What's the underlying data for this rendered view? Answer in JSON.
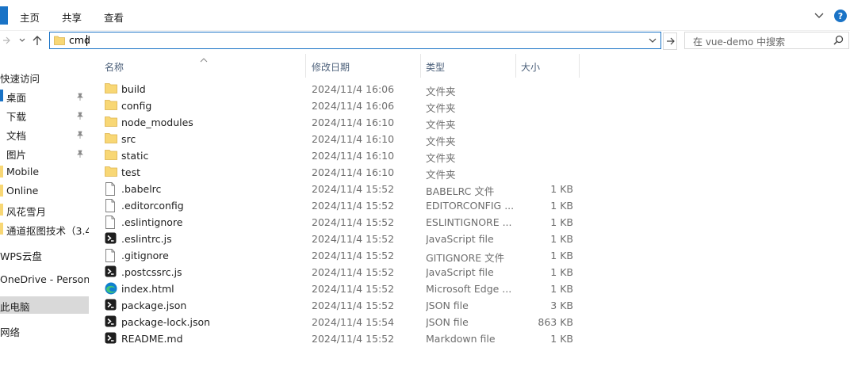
{
  "ribbon": {
    "tabs": [
      "主页",
      "共享",
      "查看"
    ]
  },
  "address": {
    "value": "cmd"
  },
  "search": {
    "placeholder": "在 vue-demo 中搜索"
  },
  "sidebar": {
    "items": [
      {
        "label": "快速访问",
        "pinned": false
      },
      {
        "label": "桌面",
        "pinned": true
      },
      {
        "label": "下载",
        "pinned": true
      },
      {
        "label": "文档",
        "pinned": true
      },
      {
        "label": "图片",
        "pinned": true
      },
      {
        "label": "Mobile",
        "pinned": false
      },
      {
        "label": "Online",
        "pinned": false
      },
      {
        "label": "风花雪月",
        "pinned": false
      },
      {
        "label": "通道抠图技术（3.4",
        "pinned": false
      },
      {
        "label": "WPS云盘",
        "pinned": false
      },
      {
        "label": "OneDrive - Persona",
        "pinned": false
      },
      {
        "label": "此电脑",
        "pinned": false,
        "selected": true
      },
      {
        "label": "网络",
        "pinned": false
      }
    ]
  },
  "columns": {
    "name": "名称",
    "date": "修改日期",
    "type": "类型",
    "size": "大小"
  },
  "files": [
    {
      "name": "build",
      "date": "2024/11/4 16:06",
      "type": "文件夹",
      "size": "",
      "icon": "folder-icon"
    },
    {
      "name": "config",
      "date": "2024/11/4 16:06",
      "type": "文件夹",
      "size": "",
      "icon": "folder-icon"
    },
    {
      "name": "node_modules",
      "date": "2024/11/4 16:10",
      "type": "文件夹",
      "size": "",
      "icon": "folder-icon"
    },
    {
      "name": "src",
      "date": "2024/11/4 16:10",
      "type": "文件夹",
      "size": "",
      "icon": "folder-icon"
    },
    {
      "name": "static",
      "date": "2024/11/4 16:10",
      "type": "文件夹",
      "size": "",
      "icon": "folder-icon"
    },
    {
      "name": "test",
      "date": "2024/11/4 16:10",
      "type": "文件夹",
      "size": "",
      "icon": "folder-icon"
    },
    {
      "name": ".babelrc",
      "date": "2024/11/4 15:52",
      "type": "BABELRC 文件",
      "size": "1 KB",
      "icon": "file-icon"
    },
    {
      "name": ".editorconfig",
      "date": "2024/11/4 15:52",
      "type": "EDITORCONFIG ...",
      "size": "1 KB",
      "icon": "file-icon"
    },
    {
      "name": ".eslintignore",
      "date": "2024/11/4 15:52",
      "type": "ESLINTIGNORE ...",
      "size": "1 KB",
      "icon": "file-icon"
    },
    {
      "name": ".eslintrc.js",
      "date": "2024/11/4 15:52",
      "type": "JavaScript file",
      "size": "1 KB",
      "icon": "code-file-icon"
    },
    {
      "name": ".gitignore",
      "date": "2024/11/4 15:52",
      "type": "GITIGNORE 文件",
      "size": "1 KB",
      "icon": "file-icon"
    },
    {
      "name": ".postcssrc.js",
      "date": "2024/11/4 15:52",
      "type": "JavaScript file",
      "size": "1 KB",
      "icon": "code-file-icon"
    },
    {
      "name": "index.html",
      "date": "2024/11/4 15:52",
      "type": "Microsoft Edge ...",
      "size": "1 KB",
      "icon": "edge-icon"
    },
    {
      "name": "package.json",
      "date": "2024/11/4 15:52",
      "type": "JSON file",
      "size": "3 KB",
      "icon": "code-file-icon"
    },
    {
      "name": "package-lock.json",
      "date": "2024/11/4 15:54",
      "type": "JSON file",
      "size": "863 KB",
      "icon": "code-file-icon"
    },
    {
      "name": "README.md",
      "date": "2024/11/4 15:52",
      "type": "Markdown file",
      "size": "1 KB",
      "icon": "code-file-icon"
    }
  ],
  "colors": {
    "accent": "#1a73c6",
    "folder": "#f8d775",
    "selected": "#d9d9d9"
  }
}
